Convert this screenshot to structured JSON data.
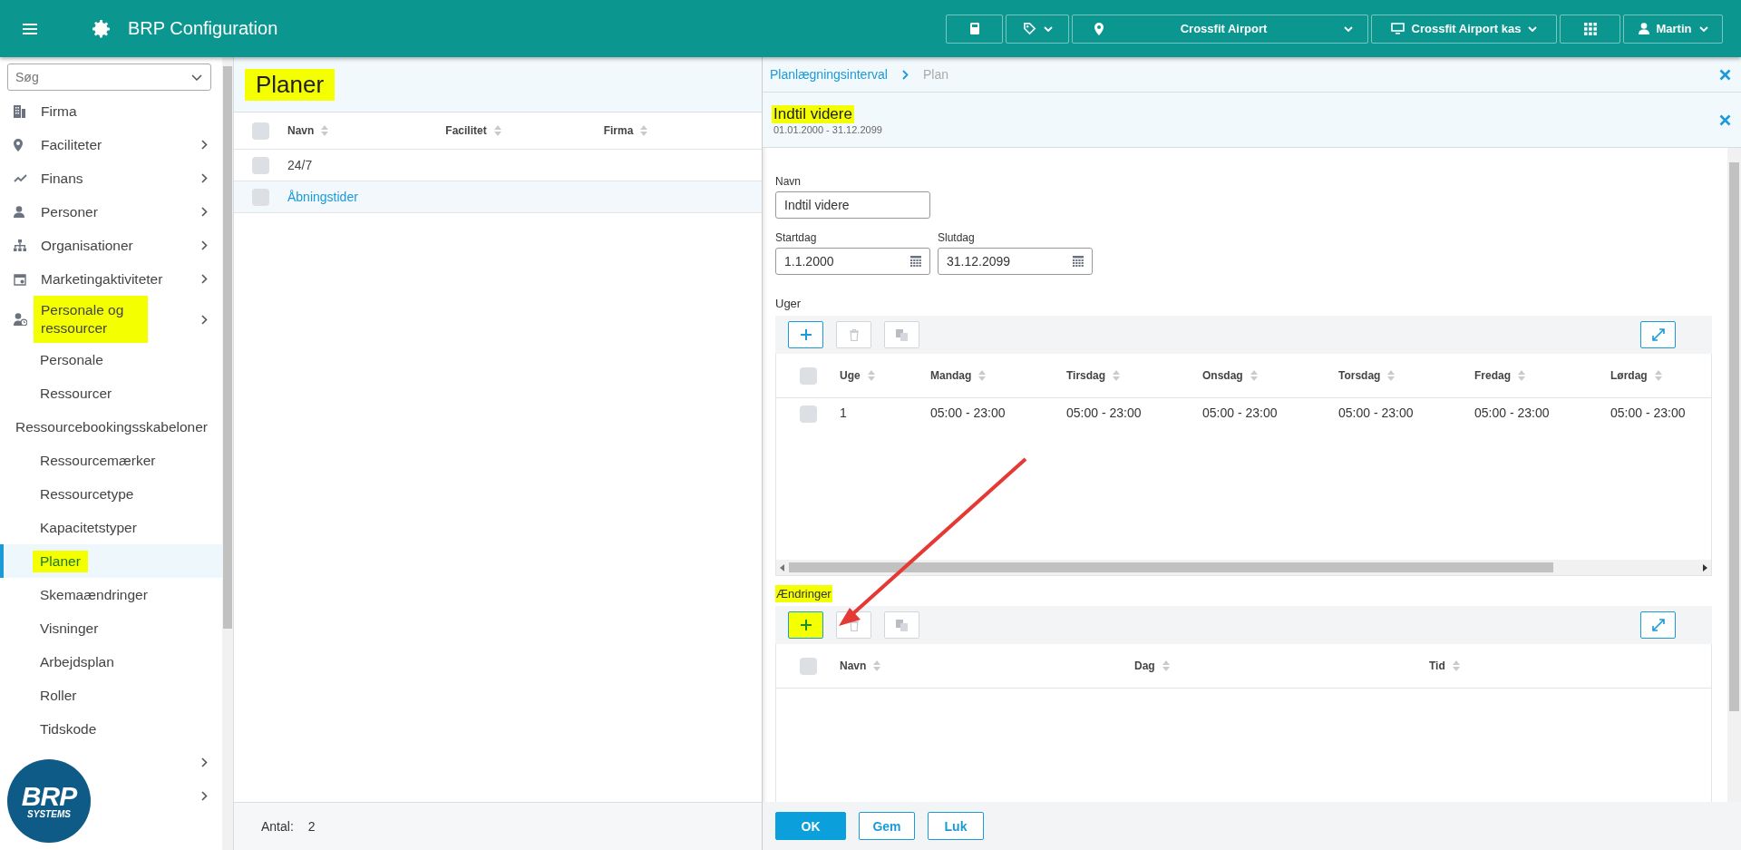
{
  "topbar": {
    "title": "BRP Configuration",
    "location": "Crossfit Airport",
    "workstation": "Crossfit Airport kas",
    "user": "Martin"
  },
  "sidebar": {
    "search": {
      "placeholder": "Søg"
    },
    "items": [
      {
        "label": "Firma",
        "has_arrow": false,
        "highlighted": false,
        "selected": false
      },
      {
        "label": "Faciliteter",
        "has_arrow": true,
        "highlighted": false,
        "selected": false
      },
      {
        "label": "Finans",
        "has_arrow": true,
        "highlighted": false,
        "selected": false
      },
      {
        "label": "Personer",
        "has_arrow": true,
        "highlighted": false,
        "selected": false
      },
      {
        "label": "Organisationer",
        "has_arrow": true,
        "highlighted": false,
        "selected": false
      },
      {
        "label": "Marketingaktiviteter",
        "has_arrow": true,
        "highlighted": false,
        "selected": false
      },
      {
        "label": "Personale og ressourcer",
        "has_arrow": true,
        "highlighted": true,
        "selected": false,
        "children": [
          {
            "label": "Personale",
            "highlighted": false,
            "selected": false
          },
          {
            "label": "Ressourcer",
            "highlighted": false,
            "selected": false
          }
        ]
      },
      {
        "label": "Ressourcebookingsskabeloner",
        "has_arrow": false,
        "highlighted": false,
        "selected": false,
        "children": [
          {
            "label": "Ressourcemærker",
            "highlighted": false,
            "selected": false
          },
          {
            "label": "Ressourcetype",
            "highlighted": false,
            "selected": false
          },
          {
            "label": "Kapacitetstyper",
            "highlighted": false,
            "selected": false
          },
          {
            "label": "Planer",
            "highlighted": true,
            "selected": true
          },
          {
            "label": "Skemaændringer",
            "highlighted": false,
            "selected": false
          },
          {
            "label": "Visninger",
            "highlighted": false,
            "selected": false
          },
          {
            "label": "Arbejdsplan",
            "highlighted": false,
            "selected": false
          },
          {
            "label": "Roller",
            "highlighted": false,
            "selected": false
          },
          {
            "label": "Tidskode",
            "highlighted": false,
            "selected": false
          }
        ]
      },
      {
        "has_arrow": true
      },
      {
        "has_arrow": true
      }
    ],
    "logo": {
      "name": "BRP",
      "tagline": "SYSTEMS"
    }
  },
  "list": {
    "title": "Planer",
    "title_highlighted": true,
    "columns": [
      "Navn",
      "Facilitet",
      "Firma"
    ],
    "all_checked": false,
    "rows": [
      {
        "name": "24/7",
        "selected": false,
        "checked": false
      },
      {
        "name": "Åbningstider",
        "selected": true,
        "checked": false
      }
    ],
    "footer": {
      "label": "Antal:",
      "count": "2"
    }
  },
  "detail": {
    "breadcrumb": [
      {
        "label": "Planlægningsinterval",
        "selected": false
      },
      {
        "label": "Plan",
        "selected": true
      }
    ],
    "header": {
      "title": "Indtil videre",
      "subtitle": "01.01.2000 - 31.12.2099",
      "highlighted": true
    },
    "name_field": {
      "label": "Navn",
      "value": "Indtil videre"
    },
    "start_field": {
      "label": "Startdag",
      "value": "1.1.2000"
    },
    "end_field": {
      "label": "Slutdag",
      "value": "31.12.2099"
    },
    "weeks": {
      "label": "Uger",
      "highlighted": false,
      "toolbar": [
        {
          "kind": "add",
          "disabled": false,
          "highlighted": false
        },
        {
          "kind": "delete",
          "disabled": true,
          "highlighted": false
        },
        {
          "kind": "copy",
          "disabled": true,
          "highlighted": false
        }
      ],
      "columns": [
        "Uge",
        "Mandag",
        "Tirsdag",
        "Onsdag",
        "Torsdag",
        "Fredag",
        "Lørdag"
      ],
      "all_checked": false,
      "rows": [
        {
          "checked": false,
          "cells": [
            "1",
            "05:00 - 23:00",
            "05:00 - 23:00",
            "05:00 - 23:00",
            "05:00 - 23:00",
            "05:00 - 23:00",
            "05:00 - 23:00"
          ]
        }
      ]
    },
    "changes": {
      "label": "Ændringer",
      "highlighted": true,
      "toolbar": [
        {
          "kind": "add",
          "disabled": false,
          "highlighted": true
        },
        {
          "kind": "delete",
          "disabled": true,
          "highlighted": false
        },
        {
          "kind": "copy",
          "disabled": true,
          "highlighted": false
        }
      ],
      "columns": [
        "Navn",
        "Dag",
        "Tid"
      ],
      "all_checked": false
    },
    "buttons": [
      {
        "label": "OK",
        "kind": "primary"
      },
      {
        "label": "Gem",
        "kind": "secondary"
      },
      {
        "label": "Luk",
        "kind": "secondary"
      }
    ]
  }
}
